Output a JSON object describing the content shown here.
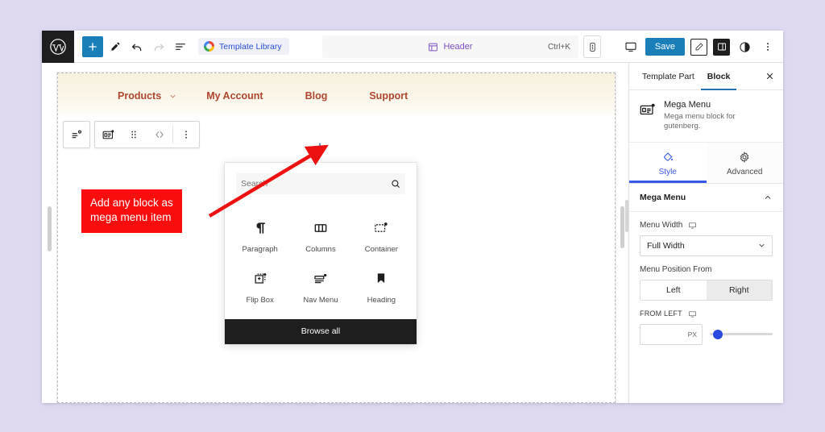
{
  "topbar": {
    "logo_icon": "wordpress-logo-icon",
    "add_block_icon": "plus-icon",
    "edit_icon": "pencil-icon",
    "undo_icon": "undo-arrow-icon",
    "redo_icon": "redo-arrow-icon",
    "list_view_icon": "list-view-icon",
    "template_library_label": "Template Library",
    "template_library_icon": "google-g-icon",
    "document_title": "Header",
    "document_icon": "template-part-icon",
    "shortcut": "Ctrl+K",
    "doc_options_icon": "vertical-dots-in-box-icon",
    "desktop_icon": "desktop-preview-icon",
    "save_label": "Save",
    "styles_icon": "styles-pencil-icon",
    "settings_icon": "settings-sidebar-icon",
    "contrast_icon": "contrast-circle-icon",
    "more_icon": "three-dots-vertical-icon"
  },
  "canvas": {
    "nav": {
      "items": [
        {
          "label": "Products",
          "has_dropdown": true
        },
        {
          "label": "My Account",
          "has_dropdown": false
        },
        {
          "label": "Blog",
          "has_dropdown": false
        },
        {
          "label": "Support",
          "has_dropdown": false
        }
      ],
      "link_color": "#b0462e",
      "bg_color": "#f7f0dd"
    },
    "block_toolbar": {
      "parent_select_icon": "select-parent-mega-menu-icon",
      "block_icon": "mega-menu-block-icon",
      "drag_icon": "drag-handle-icon",
      "move_icon": "move-up-down-icon",
      "options_icon": "block-options-dots-icon"
    },
    "inserter_plus_icon": "plus-inserter-icon",
    "annotation": {
      "text": "Add any block as\nmega menu item",
      "line1": "Add any block as",
      "line2": "mega menu item",
      "bg_color": "#fb0d0d",
      "text_color": "#ffffff",
      "arrow_color": "#ee1111"
    },
    "inserter": {
      "search_placeholder": "Search",
      "search_value": "",
      "search_icon": "magnifier-icon",
      "blocks": [
        {
          "label": "Paragraph",
          "icon": "paragraph-pilcrow-icon"
        },
        {
          "label": "Columns",
          "icon": "columns-icon"
        },
        {
          "label": "Container",
          "icon": "container-icon"
        },
        {
          "label": "Flip Box",
          "icon": "flip-box-icon"
        },
        {
          "label": "Nav Menu",
          "icon": "nav-menu-icon"
        },
        {
          "label": "Heading",
          "icon": "heading-bookmark-icon"
        }
      ],
      "browse_all_label": "Browse all"
    }
  },
  "sidebar": {
    "tabs": [
      {
        "label": "Template Part",
        "active": false
      },
      {
        "label": "Block",
        "active": true
      }
    ],
    "close_icon": "close-x-icon",
    "block": {
      "icon": "mega-menu-block-icon",
      "title": "Mega Menu",
      "description": "Mega menu block for gutenberg."
    },
    "style_tabs": [
      {
        "label": "Style",
        "icon": "paint-bucket-icon",
        "active": true
      },
      {
        "label": "Advanced",
        "icon": "gear-icon",
        "active": false
      }
    ],
    "panel": {
      "title": "Mega Menu",
      "collapse_icon": "chevron-up-icon"
    },
    "fields": {
      "menu_width": {
        "label": "Menu Width",
        "responsive_icon": "desktop-device-icon",
        "value": "Full Width",
        "dropdown_icon": "chevron-down-icon"
      },
      "menu_position_from": {
        "label": "Menu Position From",
        "options": [
          {
            "label": "Left",
            "selected": false
          },
          {
            "label": "Right",
            "selected": true
          }
        ]
      },
      "from_left": {
        "label": "FROM LEFT",
        "responsive_icon": "desktop-device-icon",
        "value": "",
        "unit": "PX",
        "slider_percent": 4,
        "accent_color": "#2a4ae0"
      }
    }
  }
}
